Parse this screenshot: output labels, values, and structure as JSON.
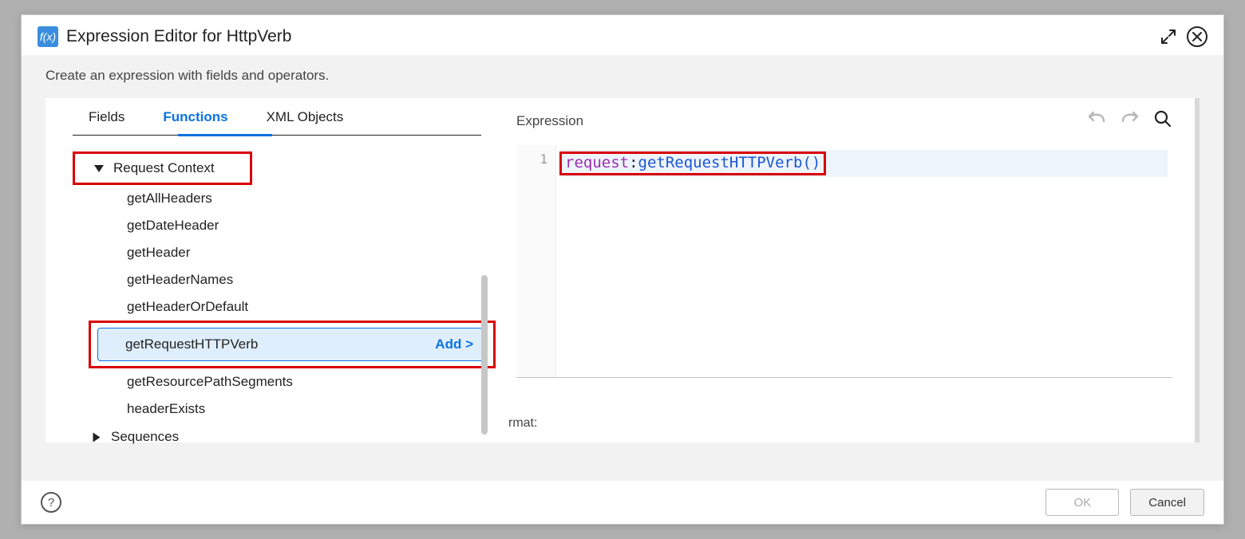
{
  "dialog": {
    "title": "Expression Editor for HttpVerb",
    "subtitle": "Create an expression with fields and operators."
  },
  "tabs": {
    "fields": "Fields",
    "functions": "Functions",
    "xml_objects": "XML Objects"
  },
  "tree": {
    "group_request_context": "Request Context",
    "items": {
      "getAllHeaders": "getAllHeaders",
      "getDateHeader": "getDateHeader",
      "getHeader": "getHeader",
      "getHeaderNames": "getHeaderNames",
      "getHeaderOrDefault": "getHeaderOrDefault",
      "getRequestHTTPVerb": "getRequestHTTPVerb",
      "getResourcePathSegments": "getResourcePathSegments",
      "headerExists": "headerExists"
    },
    "add_label": "Add >",
    "group_sequences": "Sequences"
  },
  "expression": {
    "label": "Expression",
    "line_number": "1",
    "code_namespace": "request",
    "code_colon": ":",
    "code_function": "getRequestHTTPVerb",
    "code_parens": "()"
  },
  "stray": {
    "rmat": "rmat:"
  },
  "footer": {
    "ok": "OK",
    "cancel": "Cancel",
    "help": "?"
  },
  "icons": {
    "fx": "f(x)"
  }
}
